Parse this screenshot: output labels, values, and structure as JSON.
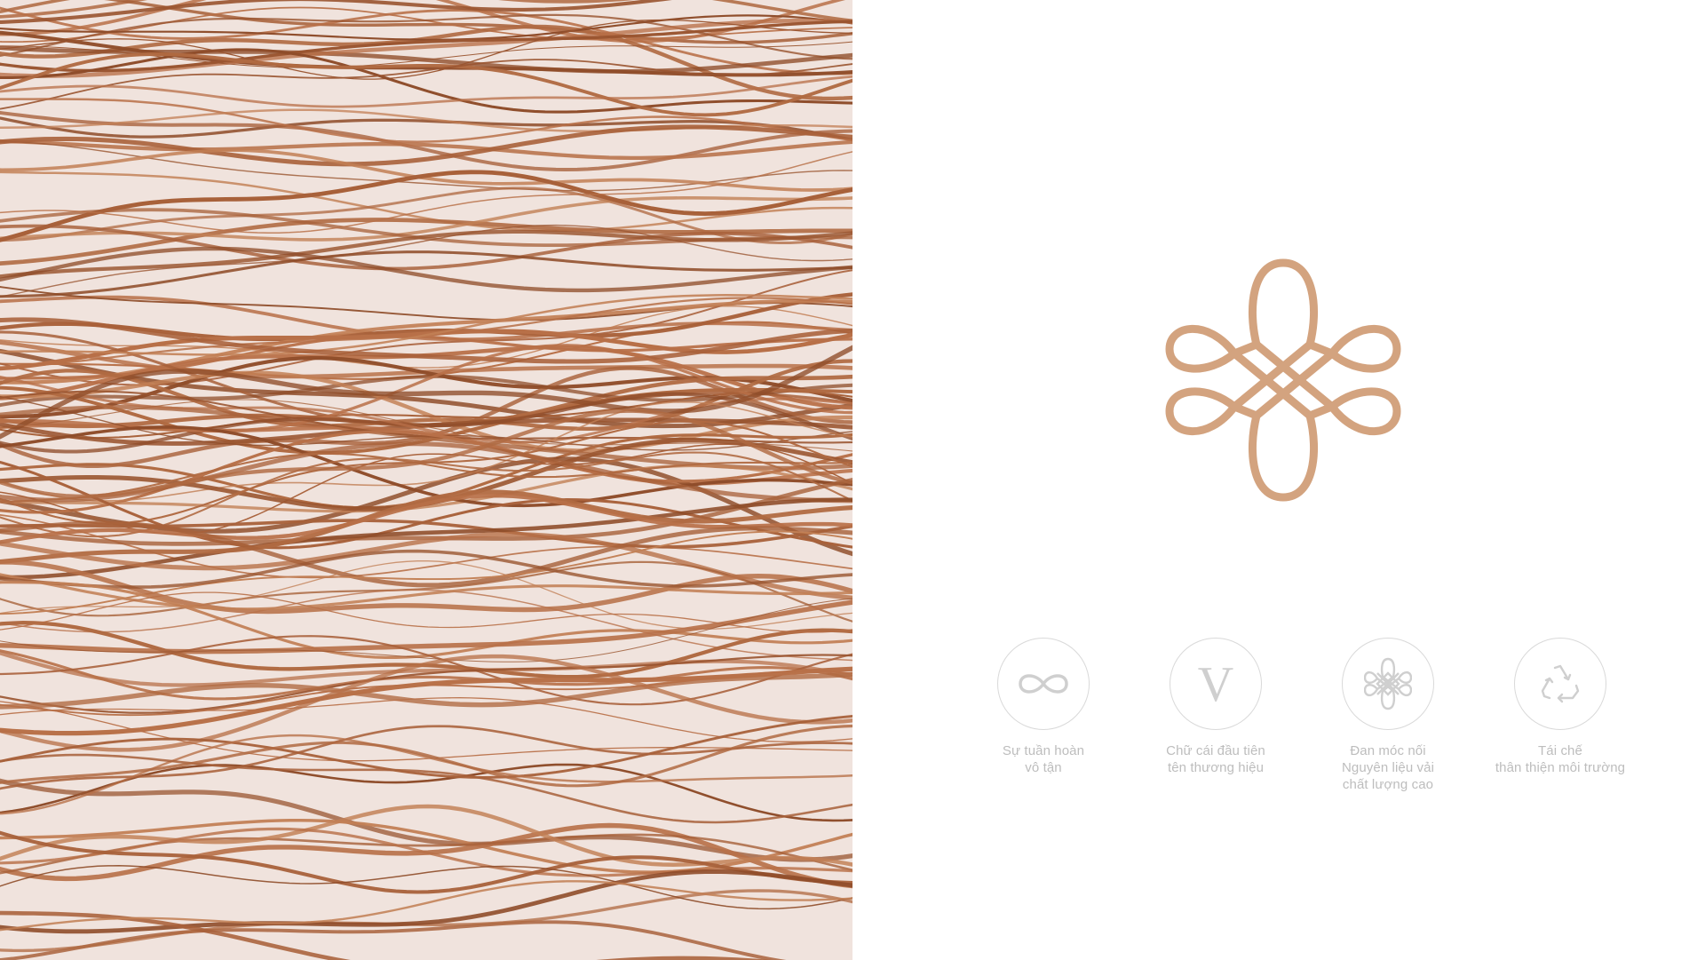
{
  "brand": {
    "accent_color": "#d3a37f",
    "hero_art": "flowing-copper-fibers-image",
    "logo_icon": "knot-logo-icon"
  },
  "features": [
    {
      "icon": "infinity-icon",
      "caption": "Sự tuần hoàn\nvô tận"
    },
    {
      "icon": "letter-v-icon",
      "glyph": "V",
      "caption": "Chữ cái đầu tiên\ntên thương hiệu"
    },
    {
      "icon": "endless-knot-icon",
      "caption": "Đan móc nối\nNguyên liệu vải\nchất lượng cao"
    },
    {
      "icon": "recycle-icon",
      "caption": "Tái chế\nthân thiện môi trường"
    }
  ]
}
